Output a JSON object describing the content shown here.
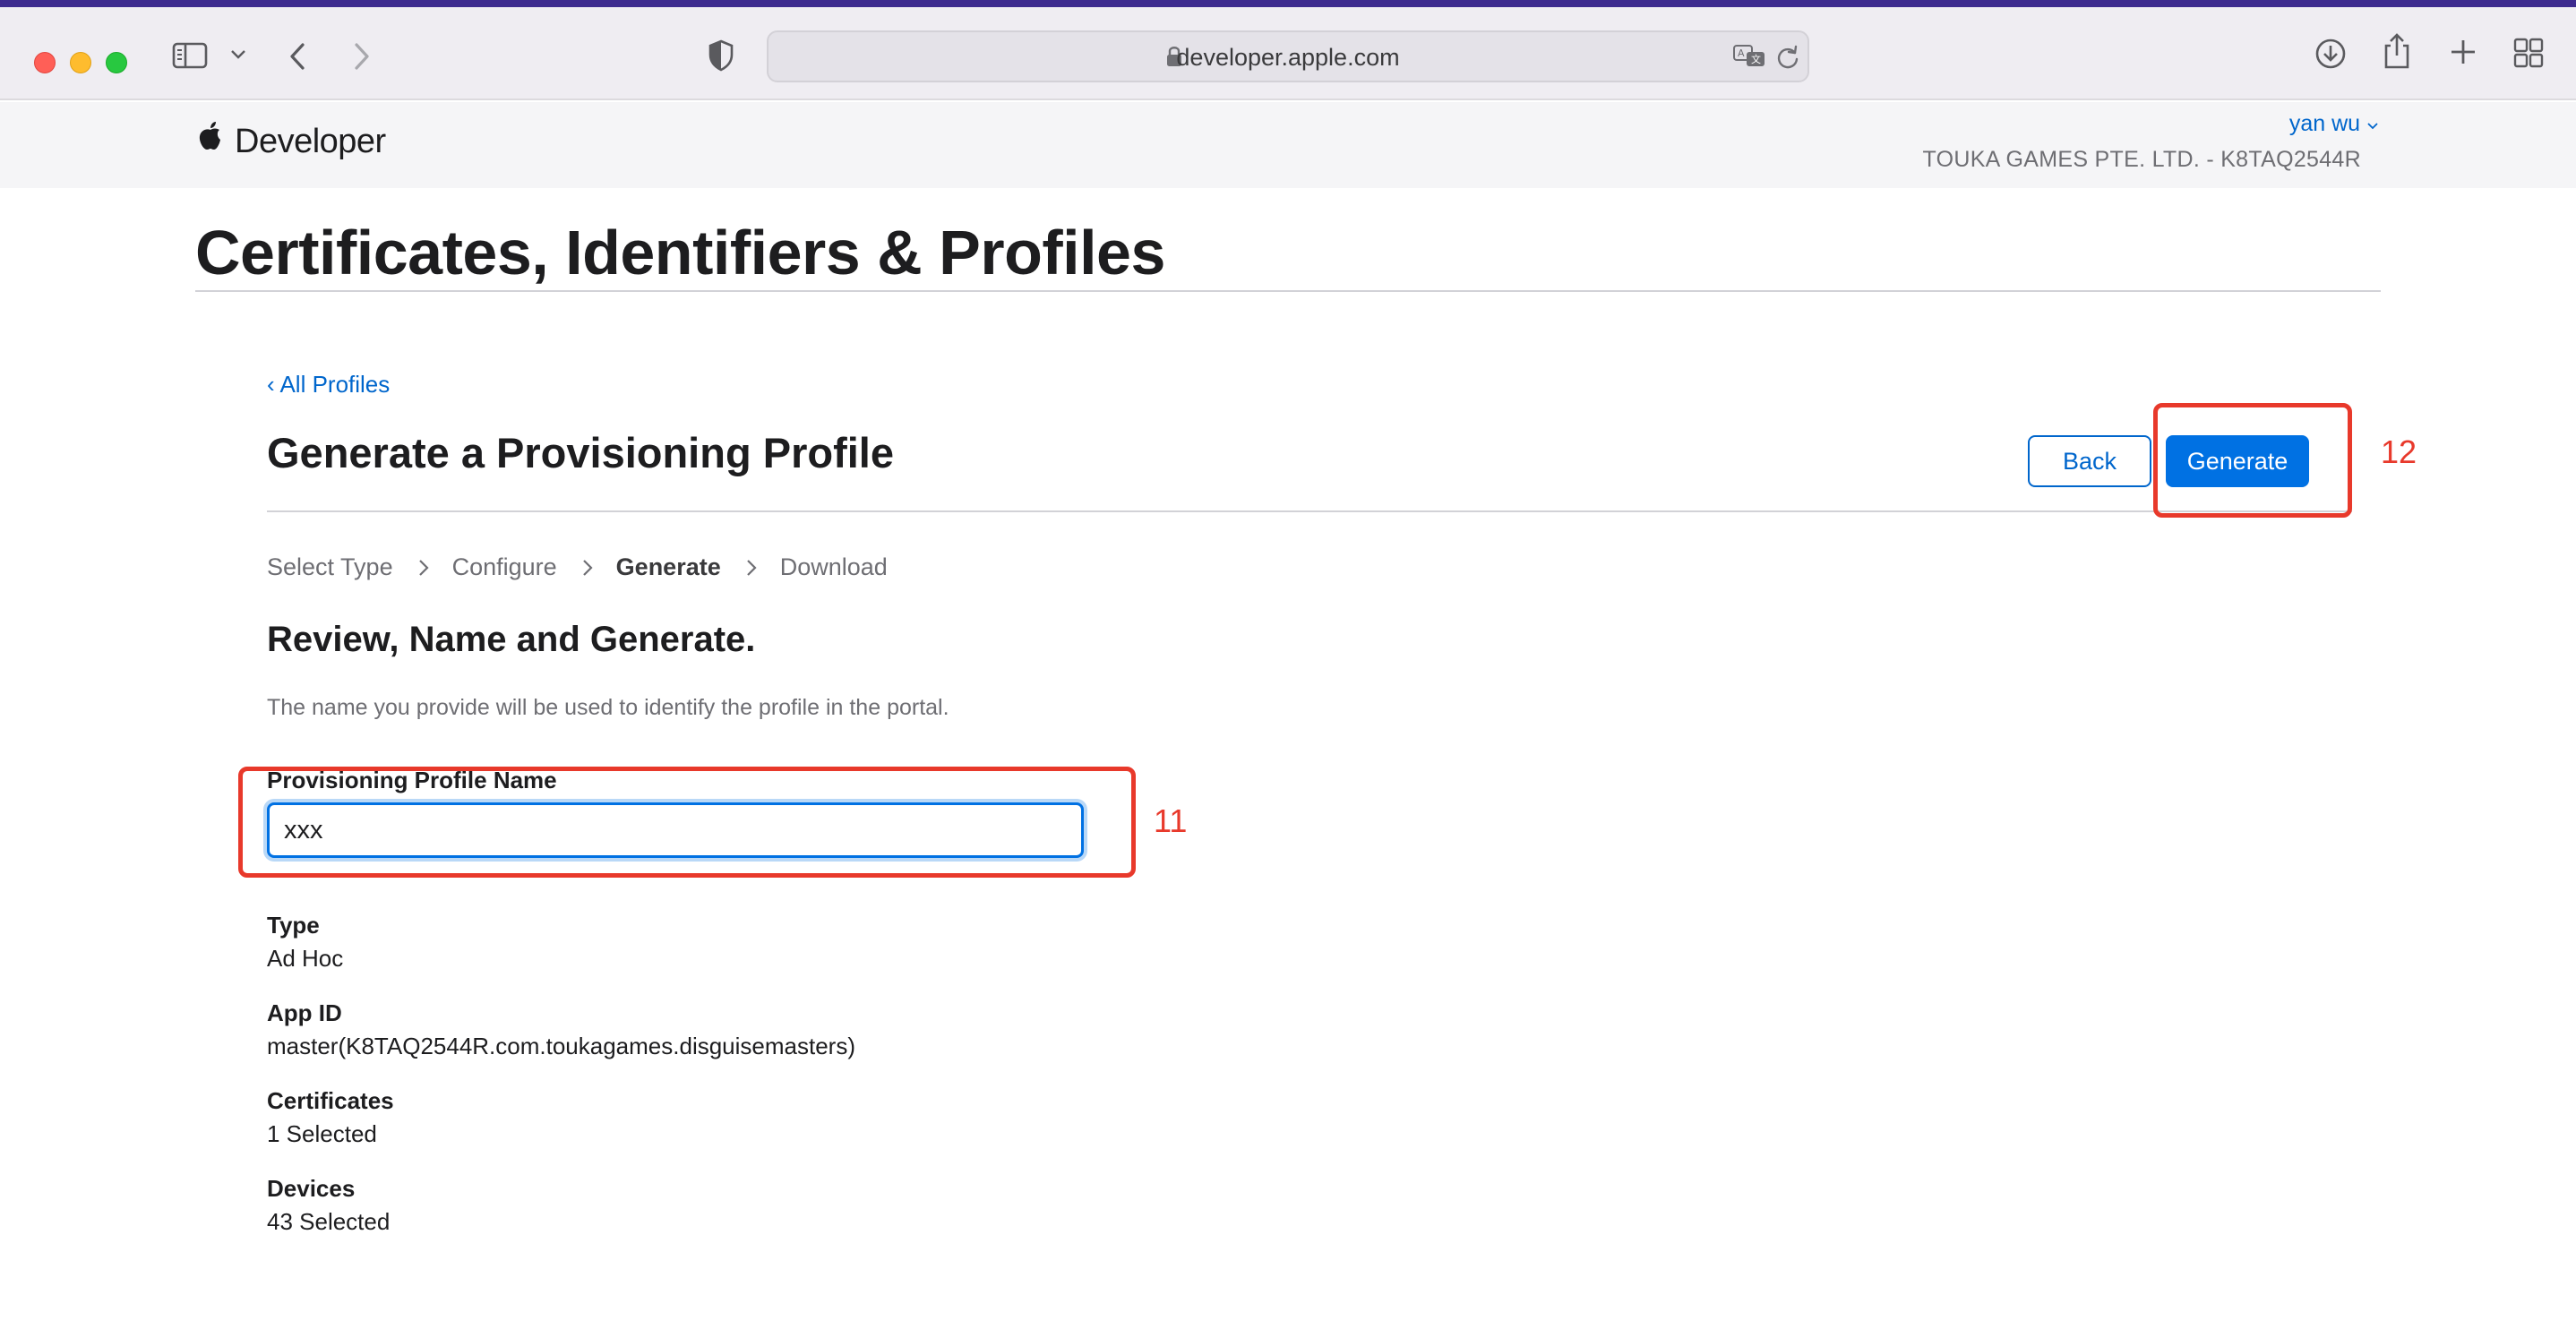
{
  "browser": {
    "url": "developer.apple.com"
  },
  "header": {
    "brand": "Developer",
    "user_name": "yan wu",
    "team": "TOUKA GAMES PTE. LTD. - K8TAQ2544R"
  },
  "page": {
    "title": "Certificates, Identifiers & Profiles",
    "back_link": "‹ All Profiles",
    "section_title": "Generate a Provisioning Profile",
    "back_button": "Back",
    "generate_button": "Generate",
    "steps": [
      "Select Type",
      "Configure",
      "Generate",
      "Download"
    ],
    "current_step": "Generate",
    "review_title": "Review, Name and Generate.",
    "review_description": "The name you provide will be used to identify the profile in the portal.",
    "name_field": {
      "label": "Provisioning Profile Name",
      "value": "xxx"
    },
    "details": [
      {
        "label": "Type",
        "value": "Ad Hoc"
      },
      {
        "label": "App ID",
        "value": "master(K8TAQ2544R.com.toukagames.disguisemasters)"
      },
      {
        "label": "Certificates",
        "value": "1 Selected"
      },
      {
        "label": "Devices",
        "value": "43 Selected"
      }
    ]
  },
  "annotations": {
    "input_marker": "11",
    "generate_marker": "12",
    "color": "#e8392b"
  },
  "colors": {
    "link": "#0066cc",
    "primary_button": "#0071e3"
  }
}
